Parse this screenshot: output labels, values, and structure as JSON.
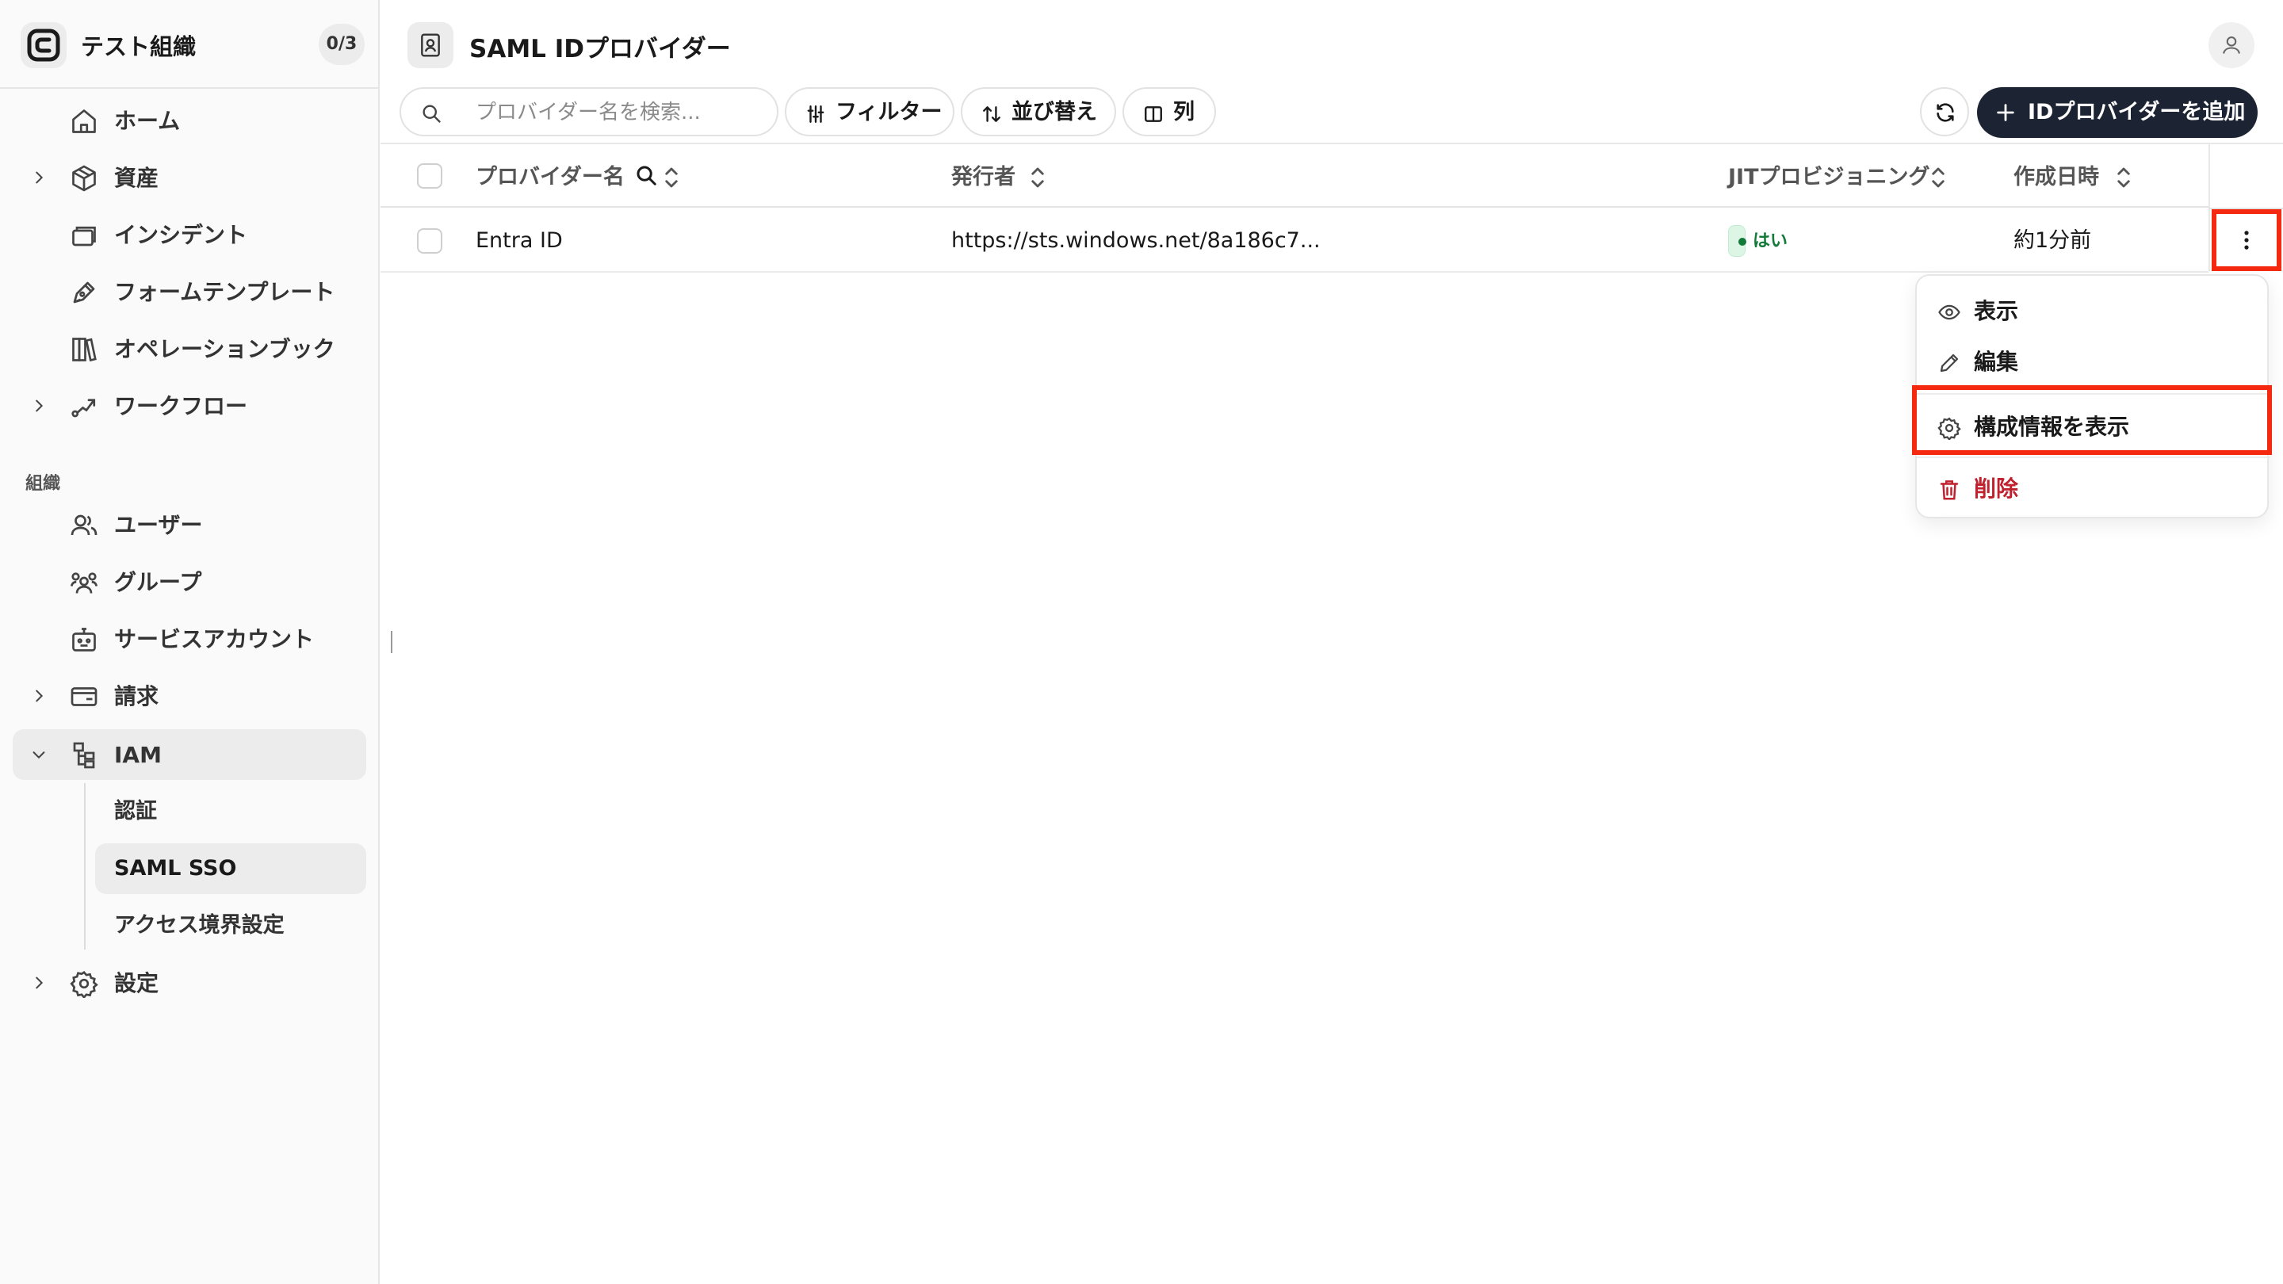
{
  "org": {
    "name": "テスト組織",
    "badge": "0/3"
  },
  "sidebar": {
    "items": [
      {
        "label": "ホーム",
        "icon": "home-icon"
      },
      {
        "label": "資産",
        "icon": "cube-icon"
      },
      {
        "label": "インシデント",
        "icon": "stack-icon"
      },
      {
        "label": "フォームテンプレート",
        "icon": "pen-icon"
      },
      {
        "label": "オペレーションブック",
        "icon": "books-icon"
      },
      {
        "label": "ワークフロー",
        "icon": "workflow-icon"
      }
    ],
    "section_label": "組織",
    "org_items": [
      {
        "label": "ユーザー",
        "icon": "users-icon"
      },
      {
        "label": "グループ",
        "icon": "group-icon"
      },
      {
        "label": "サービスアカウント",
        "icon": "robot-icon"
      },
      {
        "label": "請求",
        "icon": "wallet-icon"
      },
      {
        "label": "IAM",
        "icon": "tree-icon"
      }
    ],
    "iam_sub": [
      {
        "label": "認証"
      },
      {
        "label": "SAML SSO",
        "active": true
      },
      {
        "label": "アクセス境界設定"
      }
    ],
    "settings": {
      "label": "設定",
      "icon": "gear-icon"
    }
  },
  "header": {
    "title": "SAML IDプロバイダー"
  },
  "toolbar": {
    "search_placeholder": "プロバイダー名を検索...",
    "filter_label": "フィルター",
    "sort_label": "並び替え",
    "columns_label": "列",
    "add_label": "IDプロバイダーを追加"
  },
  "table": {
    "columns": [
      "プロバイダー名",
      "発行者",
      "JITプロビジョニング",
      "作成日時"
    ],
    "rows": [
      {
        "name": "Entra ID",
        "issuer": "https://sts.windows.net/8a186c7...",
        "jit": "はい",
        "created": "約1分前"
      }
    ]
  },
  "menu": {
    "view": "表示",
    "edit": "編集",
    "show_config": "構成情報を表示",
    "delete": "削除"
  },
  "colors": {
    "accent_dark": "#1c2433",
    "highlight": "#f5290f",
    "danger": "#c0212f",
    "success": "#137a3a"
  }
}
